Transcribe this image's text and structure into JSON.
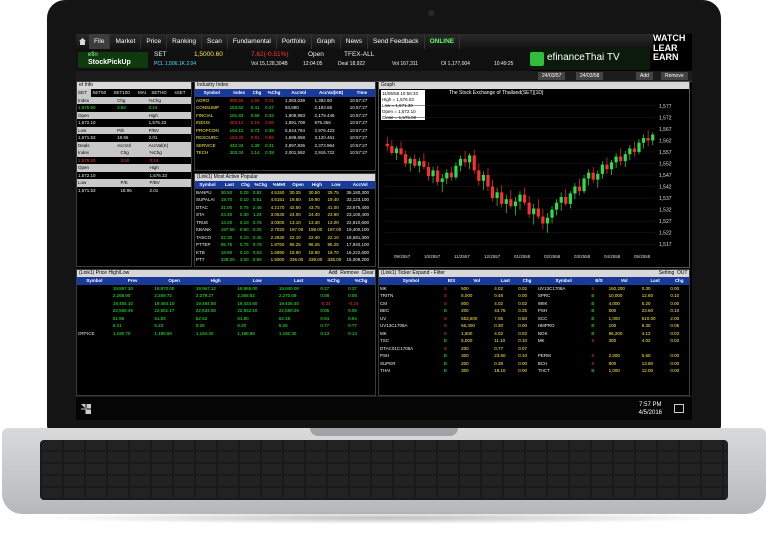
{
  "menu": [
    {
      "label": "File",
      "name": "menu-file"
    },
    {
      "label": "Market",
      "name": "menu-market"
    },
    {
      "label": "Price",
      "name": "menu-price"
    },
    {
      "label": "Ranking",
      "name": "menu-ranking"
    },
    {
      "label": "Scan",
      "name": "menu-scan"
    },
    {
      "label": "Fundamental",
      "name": "menu-fundamental"
    },
    {
      "label": "Portfolio",
      "name": "menu-portfolio"
    },
    {
      "label": "Graph",
      "name": "menu-graph"
    },
    {
      "label": "News",
      "name": "menu-news"
    },
    {
      "label": "Send Feedback",
      "name": "menu-send-feedback"
    },
    {
      "label": "ONLINE",
      "name": "status-online"
    }
  ],
  "brand": {
    "efin": "efinanceThai TV",
    "watch": [
      "WATCH",
      "LEAR",
      "EARN"
    ]
  },
  "stockpickup": {
    "line1": "efin",
    "line2": "StockPickUp"
  },
  "ticker": {
    "set_label": "SET",
    "set_value": "1,5000.60",
    "set_change": "7.62(-0.51%)",
    "open_label": "Open",
    "tfex_label": "TFEX-ALL",
    "pcl": "PCL 1,506.1K 2.04",
    "vol_set": "Vol 15,128,304B",
    "time1": "12:04:05",
    "deal": "Deal 18,922",
    "vol_tfex": "Vol 167,311",
    "oi": "OI 1,177,004",
    "time2": "10:49:25"
  },
  "toolbar2": {
    "date_from": "24/03/57",
    "date_to": "24/03/58",
    "add": "Add",
    "remove": "Remove"
  },
  "market_info": {
    "title": "et Info",
    "tabs": [
      "SET",
      "SET50",
      "SET100",
      "MAI",
      "SETHD",
      "sSET"
    ],
    "rows": [
      [
        "Index",
        "Chg",
        "%Chg"
      ],
      [
        "1,575.50",
        "3.60",
        "0.24"
      ],
      [
        "Open",
        "",
        "High"
      ],
      [
        "1,572.10",
        "",
        "1,576.33"
      ],
      [
        "Low",
        "P/E",
        "P/BV"
      ],
      [
        "1,571.53",
        "18.96",
        "2.01"
      ],
      [
        "Deals",
        "AccVol",
        "AccVal(K)"
      ]
    ]
  },
  "industry": {
    "title": "Industry Index",
    "headers": [
      "Symbol",
      "Index",
      "Chg",
      "%Chg",
      "AccVol",
      "AccVal(KB)",
      "Time"
    ],
    "rows": [
      [
        "AGRO",
        "500.55",
        "1.56",
        "0.31",
        "1,083,039",
        "1,392.60",
        "10:57:27"
      ],
      [
        "CONSUMP",
        "153.62",
        "0.41",
        "0.27",
        "93,880",
        "2,193.68",
        "10:57:27"
      ],
      [
        "FINCIAL",
        "181.83",
        "0.58",
        "0.32",
        "1,908,983",
        "2,179.446",
        "10:57:27"
      ],
      [
        "INDUS",
        "283.12",
        "0.16",
        "0.06",
        "1,891,708",
        "875.356",
        "10:57:27"
      ],
      [
        "PROPCON",
        "194.12",
        "0.73",
        "0.38",
        "5,544,784",
        "2,976.423",
        "10:57:27"
      ],
      [
        "RESOURC",
        "163.33",
        "0.91",
        "0.56",
        "1,599,658",
        "3,120.461",
        "10:57:27"
      ],
      [
        "SERVICE",
        "442.34",
        "1.39",
        "0.31",
        "2,897,836",
        "2,373.964",
        "10:57:27"
      ],
      [
        "TECH",
        "303.34",
        "1.14",
        "0.38",
        "2,001,592",
        "2,916.722",
        "10:57:27"
      ]
    ]
  },
  "most_active": {
    "title": "(Link1) Most Active Popular",
    "headers": [
      "Symbol",
      "Last",
      "Chg",
      "%Chg",
      "%MHt",
      "Open",
      "High",
      "Low",
      "AccVol"
    ],
    "rows": [
      [
        "BANPU",
        "30.50",
        "0.25",
        "0.82",
        "4.5150",
        "30.25",
        "30.50",
        "25.75",
        "36,180,300"
      ],
      [
        "SUPALAI",
        "19.70",
        "0.10",
        "0.51",
        "4.6151",
        "19.60",
        "19.90",
        "19.40",
        "33,123,100"
      ],
      [
        "DTAC",
        "31.00",
        "0.75",
        "2.48",
        "4.2170",
        "42.50",
        "43.75",
        "41.00",
        "23,675,400"
      ],
      [
        "STA",
        "24.40",
        "0.30",
        "1.24",
        "3.0530",
        "24.00",
        "24.40",
        "23.90",
        "23,100,400"
      ],
      [
        "TRUE",
        "13.20",
        "0.10",
        "0.76",
        "3.0300",
        "13.10",
        "13.30",
        "13.00",
        "22,810,600"
      ],
      [
        "KBANK",
        "197.50",
        "0.50",
        "0.25",
        "2.7020",
        "197.00",
        "198.00",
        "197.00",
        "19,400,100"
      ],
      [
        "TASCO",
        "22.30",
        "0.10",
        "0.45",
        "2.2830",
        "22.10",
        "22.40",
        "22.10",
        "18,581,300"
      ],
      [
        "PTTEP",
        "95.75",
        "0.75",
        "0.79",
        "1.8760",
        "95.25",
        "96.25",
        "95.25",
        "17,940,100"
      ],
      [
        "KTB",
        "18.80",
        "0.10",
        "0.53",
        "1.6990",
        "18.80",
        "18.90",
        "18.70",
        "16,222,600"
      ],
      [
        "PTT",
        "338.00",
        "3.00",
        "0.90",
        "1.5000",
        "336.00",
        "339.00",
        "336.00",
        "15,008,200"
      ]
    ]
  },
  "price_list": {
    "title": "(Link1) Price High/Low",
    "add": "Add",
    "remove": "Remove",
    "clear": "Clear",
    "headers": [
      "Symbol",
      "Prev",
      "Open",
      "High",
      "Low",
      "Last",
      "%Chg",
      "%Chg"
    ],
    "rows": [
      [
        "",
        "19,867.30",
        "19,870.00",
        "19,967.12",
        "19,865.00",
        "19,940.00",
        "0.37",
        "0.37"
      ],
      [
        "",
        "2,268.90",
        "2,269.72",
        "2,279.27",
        "2,266.82",
        "2,270.69",
        "0.08",
        "0.08"
      ],
      [
        "",
        "19,484.10",
        "19,484.10",
        "19,484.58",
        "19,434.60",
        "19,436.40",
        "-0.24",
        "-0.24"
      ],
      [
        "",
        "22,568.49",
        "22,561.17",
        "22,634.00",
        "22,552.10",
        "22,580.29",
        "0.05",
        "0.05"
      ],
      [
        "",
        "51.96",
        "51.83",
        "52.62",
        "51.80",
        "52.45",
        "0.94",
        "0.94"
      ],
      [
        "",
        "5.21",
        "5.23",
        "5.26",
        "5.20",
        "5.25",
        "0.77",
        "0.77"
      ],
      [
        "OFFICE",
        "1,190.70",
        "1,190.60",
        "1,194.40",
        "1,188.80",
        "1,192.30",
        "0.13",
        "0.13"
      ]
    ]
  },
  "ticker_feed": {
    "title": "(Link1) Ticker Expand - Filter",
    "setting": "Setting",
    "out": "OUT",
    "headers": [
      "Symbol",
      "B/S",
      "Vol",
      "Last",
      "Chg",
      "Symbol",
      "B/S",
      "Vol",
      "Last",
      "Chg"
    ],
    "rows": [
      [
        "MK",
        "S",
        "500",
        "4.02",
        "0.02",
        "UV13C1708A",
        "S",
        "160,200",
        "0.30",
        "0.00"
      ],
      [
        "TRITN",
        "S",
        "5,000",
        "0.48",
        "0.00",
        "SPRC",
        "B",
        "10,000",
        "12.60",
        "0.10"
      ],
      [
        "CM",
        "S",
        "800",
        "4.02",
        "0.02",
        "WIIK",
        "B",
        "4,000",
        "5.20",
        "0.00"
      ],
      [
        "BEC",
        "B",
        "200",
        "44.75",
        "0.25",
        "PSH",
        "B",
        "500",
        "23.60",
        "0.10"
      ],
      [
        "UV",
        "S",
        "553,600",
        "7.05",
        "0.50",
        "SCC",
        "B",
        "1,000",
        "510.00",
        "2.00"
      ],
      [
        "UV13C1708A",
        "S",
        "56,400",
        "0.30",
        "0.00",
        "HMPRO",
        "B",
        "100",
        "8.30",
        "0.05"
      ],
      [
        "MK",
        "S",
        "1,600",
        "4.02",
        "0.02",
        "NOK",
        "B",
        "96,200",
        "4.12",
        "0.02"
      ],
      [
        "TSC",
        "B",
        "5,000",
        "11.10",
        "0.10",
        "MK",
        "S",
        "300",
        "4.02",
        "0.02"
      ],
      [
        "DTAC01C1708A",
        "S",
        "200",
        "0.77",
        "0.07",
        "",
        "",
        "",
        "",
        ""
      ],
      [
        "PSH",
        "B",
        "300",
        "23.60",
        "0.10",
        "PERM",
        "S",
        "2,500",
        "5.60",
        "0.00"
      ],
      [
        "SUPER",
        "B",
        "200",
        "0.38",
        "0.00",
        "BCH",
        "S",
        "800",
        "13.80",
        "0.00"
      ],
      [
        "THAI",
        "B",
        "300",
        "18.10",
        "0.00",
        "THCT",
        "B",
        "1,000",
        "12.00",
        "0.00"
      ]
    ]
  },
  "chart_data": {
    "type": "candlestick",
    "title": "The Stock Exchange of Thailand(SET)[1D]",
    "legend": {
      "date": "11/05/58 10:56:33",
      "high": "High = 1,576.03",
      "low": "Low = 1,571.30",
      "open": "Open = 1,572.10",
      "close": "Close = 1,575.50"
    },
    "y_ticks": [
      "1,577",
      "1,572",
      "1,567",
      "1,562",
      "1,557",
      "1,552",
      "1,547",
      "1,542",
      "1,537",
      "1,532",
      "1,527",
      "1,522",
      "1,517"
    ],
    "x_ticks": [
      "09/2557",
      "10/2557",
      "11/2557",
      "12/2557",
      "01/2558",
      "02/2558",
      "03/2558",
      "04/2558",
      "05/2558"
    ],
    "ylim": [
      1480,
      1610
    ],
    "candles": [
      [
        1572,
        1578,
        1566,
        1570
      ],
      [
        1570,
        1575,
        1562,
        1564
      ],
      [
        1564,
        1570,
        1558,
        1568
      ],
      [
        1568,
        1574,
        1562,
        1563
      ],
      [
        1563,
        1566,
        1552,
        1555
      ],
      [
        1555,
        1561,
        1548,
        1559
      ],
      [
        1559,
        1563,
        1551,
        1553
      ],
      [
        1553,
        1560,
        1547,
        1557
      ],
      [
        1557,
        1564,
        1550,
        1552
      ],
      [
        1552,
        1556,
        1540,
        1544
      ],
      [
        1544,
        1552,
        1538,
        1549
      ],
      [
        1549,
        1553,
        1536,
        1539
      ],
      [
        1539,
        1546,
        1530,
        1542
      ],
      [
        1542,
        1550,
        1537,
        1547
      ],
      [
        1547,
        1552,
        1540,
        1543
      ],
      [
        1543,
        1556,
        1541,
        1553
      ],
      [
        1553,
        1562,
        1548,
        1559
      ],
      [
        1559,
        1566,
        1552,
        1556
      ],
      [
        1556,
        1564,
        1550,
        1562
      ],
      [
        1562,
        1567,
        1546,
        1549
      ],
      [
        1549,
        1555,
        1536,
        1540
      ],
      [
        1540,
        1548,
        1532,
        1545
      ],
      [
        1545,
        1551,
        1531,
        1535
      ],
      [
        1535,
        1541,
        1522,
        1525
      ],
      [
        1525,
        1534,
        1518,
        1530
      ],
      [
        1530,
        1536,
        1517,
        1520
      ],
      [
        1520,
        1528,
        1512,
        1524
      ],
      [
        1524,
        1532,
        1516,
        1518
      ],
      [
        1518,
        1526,
        1510,
        1522
      ],
      [
        1522,
        1531,
        1515,
        1528
      ],
      [
        1528,
        1534,
        1519,
        1521
      ],
      [
        1521,
        1527,
        1508,
        1511
      ],
      [
        1511,
        1520,
        1502,
        1516
      ],
      [
        1516,
        1524,
        1507,
        1509
      ],
      [
        1509,
        1516,
        1498,
        1503
      ],
      [
        1503,
        1512,
        1495,
        1508
      ],
      [
        1508,
        1518,
        1503,
        1515
      ],
      [
        1515,
        1524,
        1510,
        1521
      ],
      [
        1521,
        1530,
        1514,
        1526
      ],
      [
        1526,
        1533,
        1518,
        1520
      ],
      [
        1520,
        1531,
        1516,
        1529
      ],
      [
        1529,
        1538,
        1524,
        1535
      ],
      [
        1535,
        1542,
        1527,
        1531
      ],
      [
        1531,
        1545,
        1529,
        1542
      ],
      [
        1542,
        1550,
        1536,
        1547
      ],
      [
        1547,
        1552,
        1538,
        1541
      ],
      [
        1541,
        1549,
        1534,
        1546
      ],
      [
        1546,
        1557,
        1542,
        1554
      ],
      [
        1554,
        1560,
        1546,
        1550
      ],
      [
        1550,
        1558,
        1545,
        1556
      ],
      [
        1556,
        1564,
        1551,
        1561
      ],
      [
        1561,
        1568,
        1553,
        1557
      ],
      [
        1557,
        1566,
        1552,
        1563
      ],
      [
        1563,
        1571,
        1558,
        1568
      ],
      [
        1568,
        1574,
        1561,
        1565
      ],
      [
        1565,
        1576,
        1563,
        1573
      ],
      [
        1573,
        1580,
        1568,
        1577
      ],
      [
        1577,
        1584,
        1570,
        1575
      ],
      [
        1575,
        1582,
        1571,
        1580
      ]
    ]
  },
  "taskbar": {
    "time": "7:57 PM",
    "date": "4/5/2016"
  }
}
